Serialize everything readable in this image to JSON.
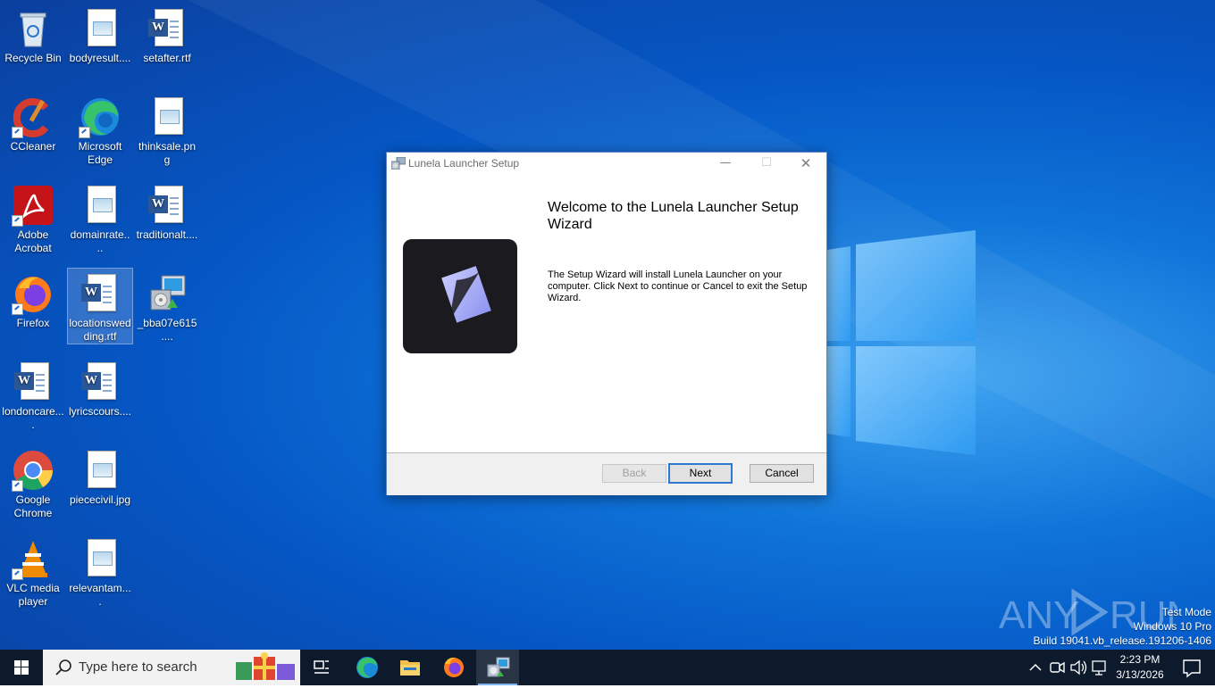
{
  "desktop": {
    "icons": [
      {
        "label": "Recycle Bin"
      },
      {
        "label": "bodyresult...."
      },
      {
        "label": "setafter.rtf"
      },
      {
        "label": "CCleaner"
      },
      {
        "label": "Microsoft Edge"
      },
      {
        "label": "thinksale.png"
      },
      {
        "label": "Adobe Acrobat"
      },
      {
        "label": "domainrate...."
      },
      {
        "label": "traditionalt...."
      },
      {
        "label": "Firefox"
      },
      {
        "label": "locationswedding.rtf"
      },
      {
        "label": "_bba07e615...."
      },
      {
        "label": "londoncare...."
      },
      {
        "label": "lyricscours...."
      },
      {
        "label": "Google Chrome"
      },
      {
        "label": "piececivil.jpg"
      },
      {
        "label": "VLC media player"
      },
      {
        "label": "relevantam...."
      }
    ]
  },
  "dialog": {
    "title": "Lunela Launcher Setup",
    "welcome_title": "Welcome to the Lunela Launcher Setup Wizard",
    "welcome_body": "The Setup Wizard will install Lunela Launcher on your computer. Click Next to continue or Cancel to exit the Setup Wizard.",
    "buttons": {
      "back": "Back",
      "next": "Next",
      "cancel": "Cancel"
    },
    "caption": {
      "minimize": "—",
      "maximize": "☐",
      "close": "✕"
    }
  },
  "watermark": {
    "text": "ANY RUN",
    "lines": [
      "Test Mode",
      "Windows 10 Pro",
      "Build 19041.vb_release.191206-1406"
    ]
  },
  "taskbar": {
    "search_placeholder": "Type here to search",
    "clock_time": "2:23 PM",
    "clock_date": "3/13/2026"
  }
}
